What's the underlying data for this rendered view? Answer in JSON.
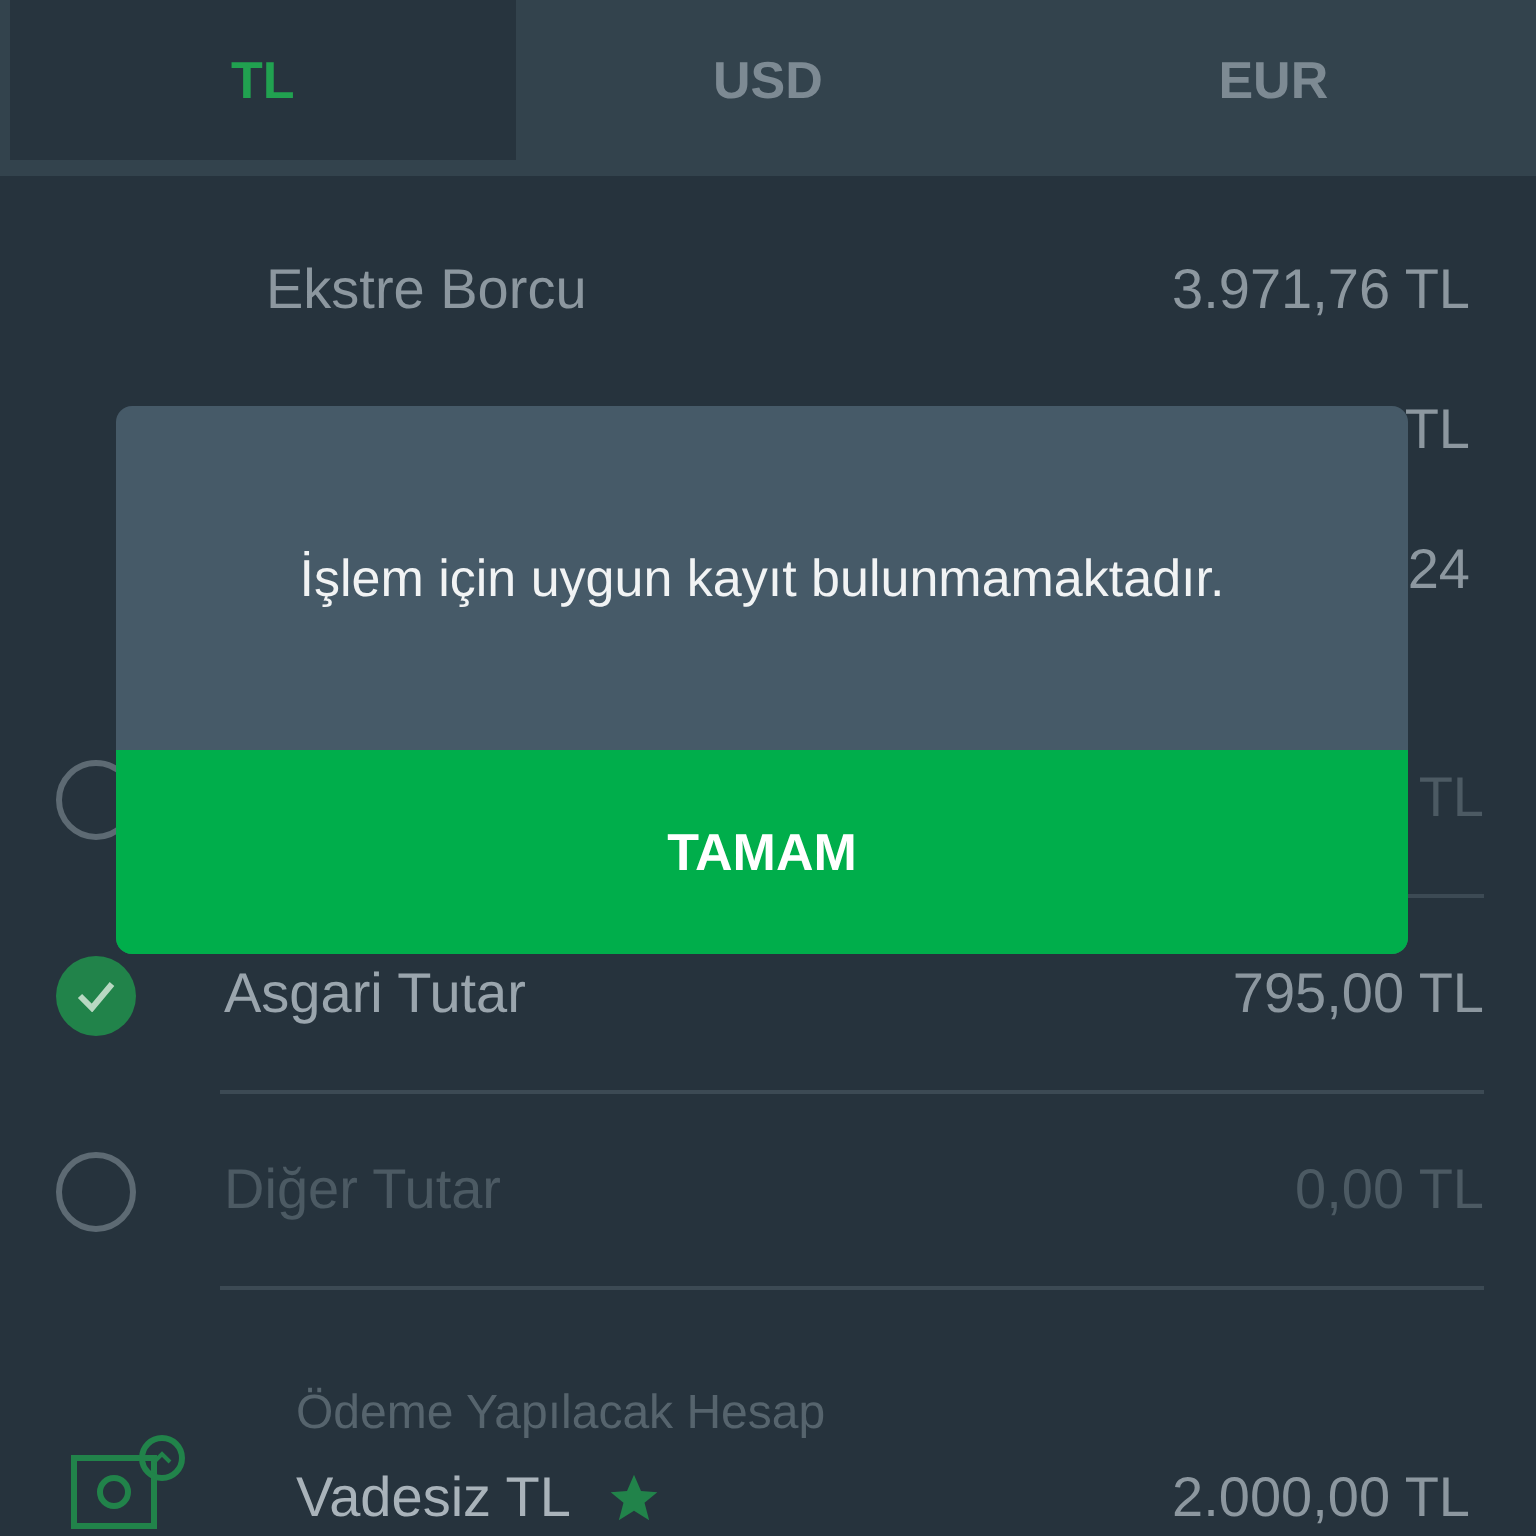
{
  "tabs": [
    {
      "label": "TL",
      "selected": true
    },
    {
      "label": "USD",
      "selected": false
    },
    {
      "label": "EUR",
      "selected": false
    }
  ],
  "rows": [
    {
      "kind": "info",
      "label": "Ekstre Borcu",
      "value": "3.971,76 TL"
    },
    {
      "kind": "info",
      "value": "TL"
    },
    {
      "kind": "info",
      "value": "24"
    },
    {
      "kind": "option",
      "selected": false,
      "value": "TL"
    },
    {
      "kind": "option",
      "selected": true,
      "label": "Asgari Tutar",
      "value": "795,00 TL"
    },
    {
      "kind": "option",
      "selected": false,
      "label": "Diğer Tutar",
      "value": "0,00 TL"
    }
  ],
  "account": {
    "caption": "Ödeme Yapılacak Hesap",
    "name": "Vadesiz TL",
    "favorite": true,
    "balance": "2.000,00 TL"
  },
  "dialog": {
    "message": "İşlem için uygun kayıt bulunmamaktadır.",
    "button": "TAMAM"
  }
}
